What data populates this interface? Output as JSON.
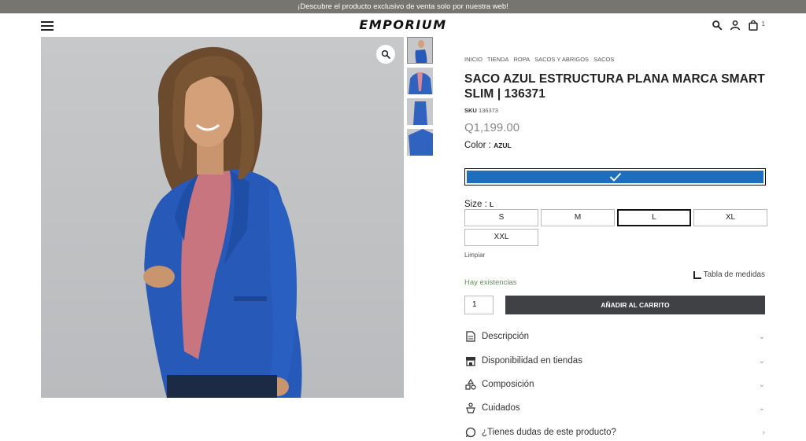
{
  "promo": {
    "text": "¡Descubre el producto exclusivo de venta solo por nuestra web!"
  },
  "header": {
    "logo": "EMPORIUM",
    "cart_count": "1"
  },
  "product": {
    "breadcrumbs": [
      "INICIO",
      "TIENDA",
      "ROPA",
      "SACOS Y ABRIGOS",
      "SACOS"
    ],
    "title": "SACO AZUL ESTRUCTURA PLANA MARCA SMART SLIM | 136371",
    "sku_label": "SKU",
    "sku_value": "136373",
    "price": "Q1,199.00",
    "color_label": "Color :",
    "color_value": "AZUL",
    "color_hex": "#1d6fbe",
    "size_label": "Size :",
    "size_value": "L",
    "sizes": [
      "S",
      "M",
      "L",
      "XL",
      "XXL"
    ],
    "selected_size": "L",
    "clear_label": "Limpiar",
    "stock_text": "Hay existencias",
    "size_chart_label": "Tabla de medidas",
    "quantity": "1",
    "add_to_cart": "AÑADIR AL CARRITO"
  },
  "accordion": [
    {
      "label": "Descripción",
      "icon": "document-icon"
    },
    {
      "label": "Disponibilidad en tiendas",
      "icon": "store-icon"
    },
    {
      "label": "Composición",
      "icon": "shapes-icon"
    },
    {
      "label": "Cuidados",
      "icon": "care-icon"
    },
    {
      "label": "¿Tienes dudas de este producto?",
      "icon": "whatsapp-icon"
    }
  ]
}
